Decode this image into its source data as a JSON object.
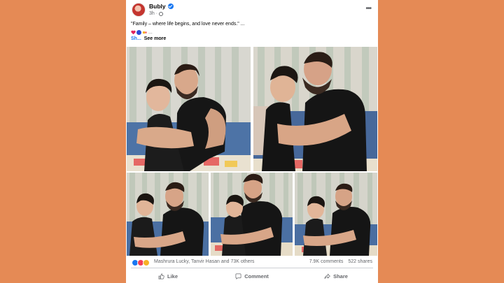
{
  "post": {
    "author": "Bubly",
    "time": "3h",
    "caption": "\"Family – where life begins, and love never ends.\" ...",
    "emoji_suffix": "...",
    "truncated_prefix": "Sh...",
    "see_more": "See more"
  },
  "engagement": {
    "reaction_names": "Mashrura Lucky, Tanvir Hasan and 73K others",
    "comments": "7.9K comments",
    "shares": "522 shares"
  },
  "actions": {
    "like": "Like",
    "comment": "Comment",
    "share": "Share"
  },
  "colors": {
    "page_background": "#e58a55",
    "card": "#ffffff",
    "accent_blue": "#1877f2"
  },
  "icons": [
    "verified-icon",
    "globe-icon",
    "more-options-icon",
    "heart-icon",
    "like-icon",
    "comment-icon",
    "share-icon"
  ]
}
